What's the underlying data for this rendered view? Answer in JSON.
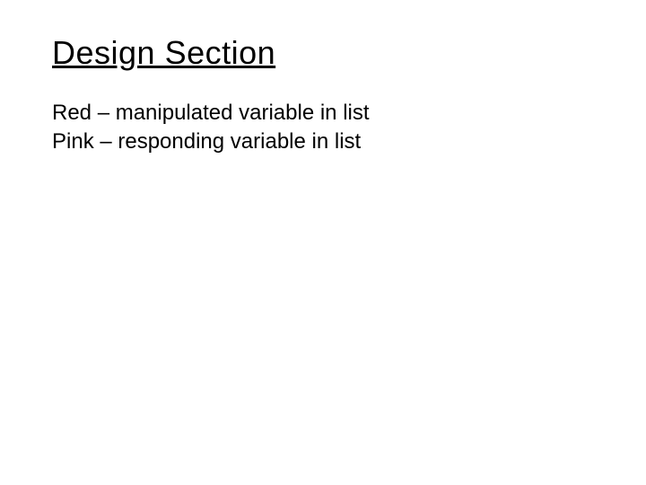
{
  "heading": "Design Section",
  "lines": {
    "line1": "Red – manipulated variable in list",
    "line2": "Pink – responding variable in list"
  }
}
